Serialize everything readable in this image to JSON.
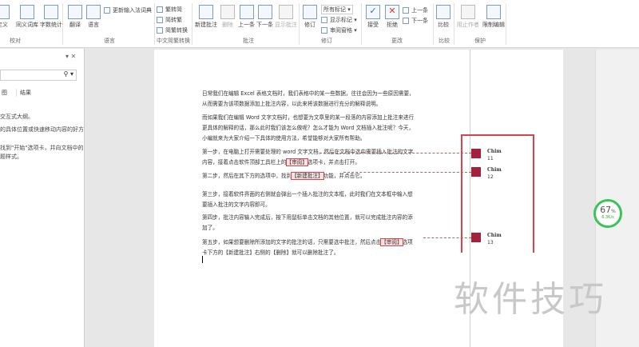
{
  "ribbon": {
    "proofing": {
      "items": [
        "定义",
        "同义词库",
        "字数统计"
      ],
      "label": "校对"
    },
    "language": {
      "items": [
        "翻译",
        "语言"
      ],
      "update_ime": "更新输入法词典",
      "label": "语言"
    },
    "chinese": {
      "items": [
        "繁转简",
        "简转繁",
        "简繁转换"
      ],
      "label": "中文简繁转换"
    },
    "comments": {
      "items": [
        "新建批注",
        "删除",
        "上一条",
        "下一条",
        "显示批注"
      ],
      "label": "批注"
    },
    "tracking": {
      "track": "修订",
      "markup": "所有标记",
      "show_markup": "显示标记",
      "pane": "审阅窗格",
      "label": "修订"
    },
    "changes": {
      "accept": "接受",
      "reject": "拒绝",
      "prev": "上一条",
      "next": "下一条",
      "label": "更改"
    },
    "compare": {
      "item": "比较",
      "label": "比较"
    },
    "protect": {
      "block": "阻止作者",
      "restrict": "限制编辑",
      "label": "保护"
    }
  },
  "nav": {
    "tabs": [
      "图",
      "结果"
    ],
    "lines": [
      "交互式大纲。",
      "的具体位置或快速移动内容的好方",
      "找到\"开始\"选项卡，并向文档中的",
      "题样式。"
    ]
  },
  "doc": {
    "paragraphs": [
      [
        "日常我们在编辑 Excel 表格文档时，我们表格中的某一些数据，往往会因为一些原因需要，",
        "从而需要为该项数据添加上批注内容，以此来将该数据进行充分的解释说明。"
      ],
      [
        "而如果我们在编辑 Word 文字文档时，也想要为文章里的某一段落的内容添加上批注来进行",
        "更具体的解释的话，那么此时我们该怎么做呢？怎么才能为 Word 文档插入批注呢？今天，",
        "小编就来为大家介绍一下具体的使用方法，希望能够对大家所有帮助。"
      ],
      [
        "第一步，在电脑上打开需要处理的 word 文字文档，然后在文档中选中需要插入批注的文字",
        "内容，接着点击软件顶部工具栏上的",
        "【审阅】",
        "选项卡，并点击打开。"
      ],
      [
        "第二步，然后在其下方的选项中，找到",
        "【新建批注】",
        "功能，并点击它。"
      ],
      [
        "第三步，接着软件界面的右侧就会弹出一个插入批注的文本框，此时我们在文本框中输入想",
        "要插入批注的文字内容即可。"
      ],
      [
        "第四步，批注内容输入完成后，按下用鼠标单击文档的其他位置，就可以完成批注内容的添",
        "加了。"
      ],
      [
        "第五步，如果想要删除所添加的文字的批注的话，只需要选中批注，然后点击",
        "【审阅】",
        "选项",
        "卡下方的【新建批注】右侧的【删除】就可以删除批注了。"
      ]
    ]
  },
  "comments": [
    {
      "author": "Chim",
      "id": "11"
    },
    {
      "author": "Chim",
      "id": "12"
    },
    {
      "author": "Chim",
      "id": "13"
    }
  ],
  "gauge": {
    "percent": "67",
    "unit": "%",
    "speed": "6.3K/s"
  },
  "watermark": "软件技巧"
}
